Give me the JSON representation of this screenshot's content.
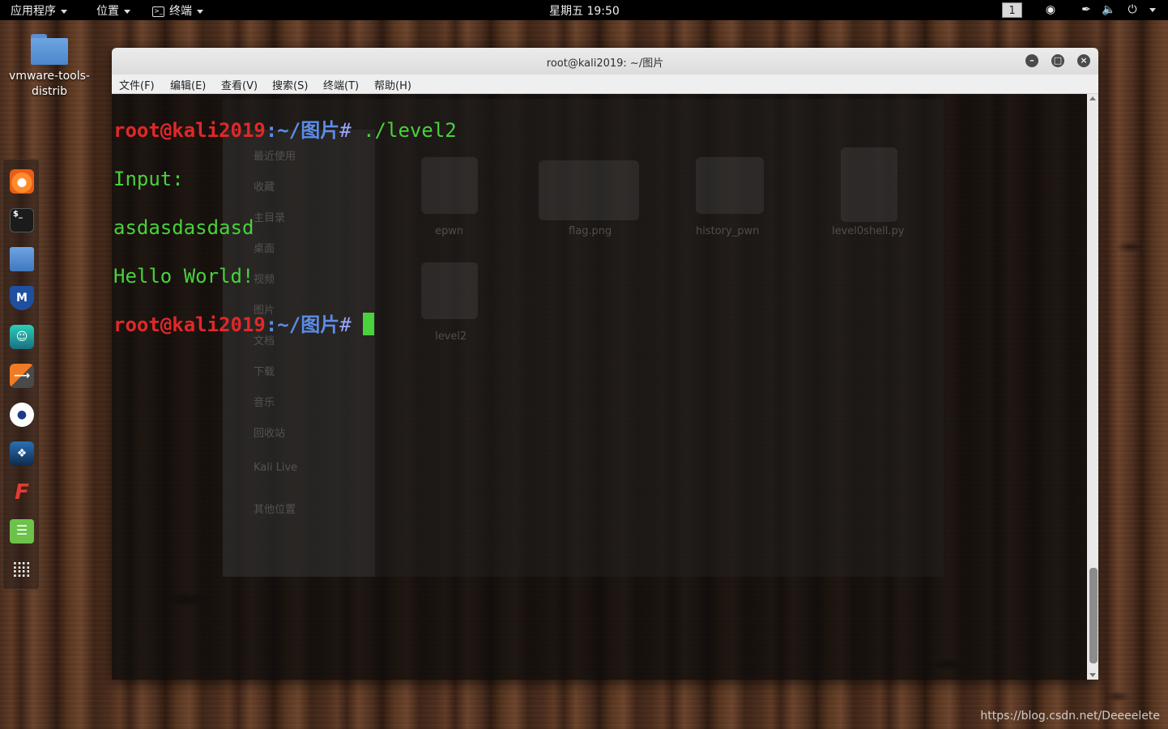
{
  "topbar": {
    "apps_label": "应用程序",
    "places_label": "位置",
    "terminal_label": "终端",
    "clock": "星期五 19:50",
    "workspace": "1"
  },
  "desktop": {
    "folder_label_line1": "vmware-tools-",
    "folder_label_line2": "distrib"
  },
  "dock": {
    "items": [
      "firefox-icon",
      "terminal-icon",
      "files-icon",
      "metasploit-icon",
      "armitage-icon",
      "burpsuite-icon",
      "maltego-icon",
      "beef-icon",
      "faraday-icon",
      "leafpad-icon",
      "show-apps-icon"
    ]
  },
  "window": {
    "title": "root@kali2019: ~/图片",
    "menu": [
      "文件(F)",
      "编辑(E)",
      "查看(V)",
      "搜索(S)",
      "终端(T)",
      "帮助(H)"
    ]
  },
  "terminal": {
    "line1_user": "root@kali2019",
    "line1_path": ":~/图片",
    "line1_hash": "# ",
    "line1_cmd": "./level2",
    "line2": "Input:",
    "line3": "asdasdasdasd",
    "line4": "Hello World!",
    "line5_user": "root@kali2019",
    "line5_path": ":~/图片",
    "line5_hash": "# "
  },
  "filemanager_ghost": {
    "sidebar": [
      "最近使用",
      "收藏",
      "主目录",
      "桌面",
      "视频",
      "图片",
      "文档",
      "下载",
      "音乐",
      "回收站",
      "Kali Live",
      "其他位置"
    ],
    "files": [
      "epwn",
      "flag.png",
      "history_pwn",
      "level0shell.py",
      "level2"
    ]
  },
  "watermark": "https://blog.csdn.net/Deeeelete"
}
